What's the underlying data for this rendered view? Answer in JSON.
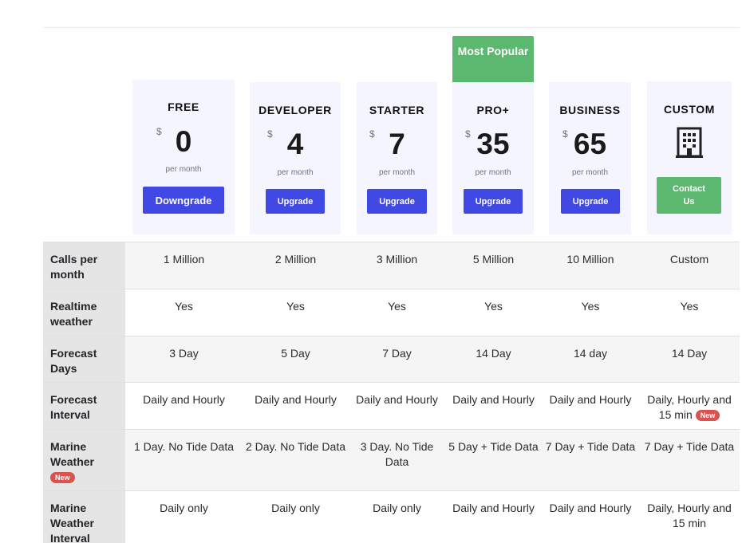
{
  "most_popular_label": "Most Popular",
  "plans": [
    {
      "name": "FREE",
      "currency": "$",
      "price": "0",
      "period": "per month",
      "cta": "Downgrade"
    },
    {
      "name": "DEVELOPER",
      "currency": "$",
      "price": "4",
      "period": "per month",
      "cta": "Upgrade"
    },
    {
      "name": "STARTER",
      "currency": "$",
      "price": "7",
      "period": "per month",
      "cta": "Upgrade"
    },
    {
      "name": "PRO+",
      "currency": "$",
      "price": "35",
      "period": "per month",
      "cta": "Upgrade"
    },
    {
      "name": "BUSINESS",
      "currency": "$",
      "price": "65",
      "period": "per month",
      "cta": "Upgrade"
    },
    {
      "name": "CUSTOM",
      "icon": "building-icon",
      "cta": "Contact Us"
    }
  ],
  "new_badge": "New",
  "features": [
    {
      "label": "Calls per month",
      "values": [
        "1 Million",
        "2 Million",
        "3 Million",
        "5 Million",
        "10 Million",
        "Custom"
      ]
    },
    {
      "label": "Realtime weather",
      "values": [
        "Yes",
        "Yes",
        "Yes",
        "Yes",
        "Yes",
        "Yes"
      ]
    },
    {
      "label": "Forecast Days",
      "values": [
        "3 Day",
        "5 Day",
        "7 Day",
        "14 Day",
        "14 day",
        "14 Day"
      ]
    },
    {
      "label": "Forecast Interval",
      "values": [
        "Daily and Hourly",
        "Daily and Hourly",
        "Daily and Hourly",
        "Daily and Hourly",
        "Daily and Hourly",
        "Daily, Hourly and 15 min"
      ]
    },
    {
      "label": "Marine Weather",
      "values": [
        "1 Day. No Tide Data",
        "2 Day. No Tide Data",
        "3 Day. No Tide Data",
        "5 Day + Tide Data",
        "7 Day + Tide Data",
        "7 Day + Tide Data"
      ]
    },
    {
      "label": "Marine Weather Interval",
      "values": [
        "Daily only",
        "Daily only",
        "Daily only",
        "Daily and Hourly",
        "Daily and Hourly",
        "Daily, Hourly and 15 min"
      ]
    }
  ],
  "colors": {
    "accent_blue": "#4149e4",
    "accent_green": "#5cb86e",
    "badge_red": "#d9534f",
    "card_bg": "#f5f5ff"
  }
}
